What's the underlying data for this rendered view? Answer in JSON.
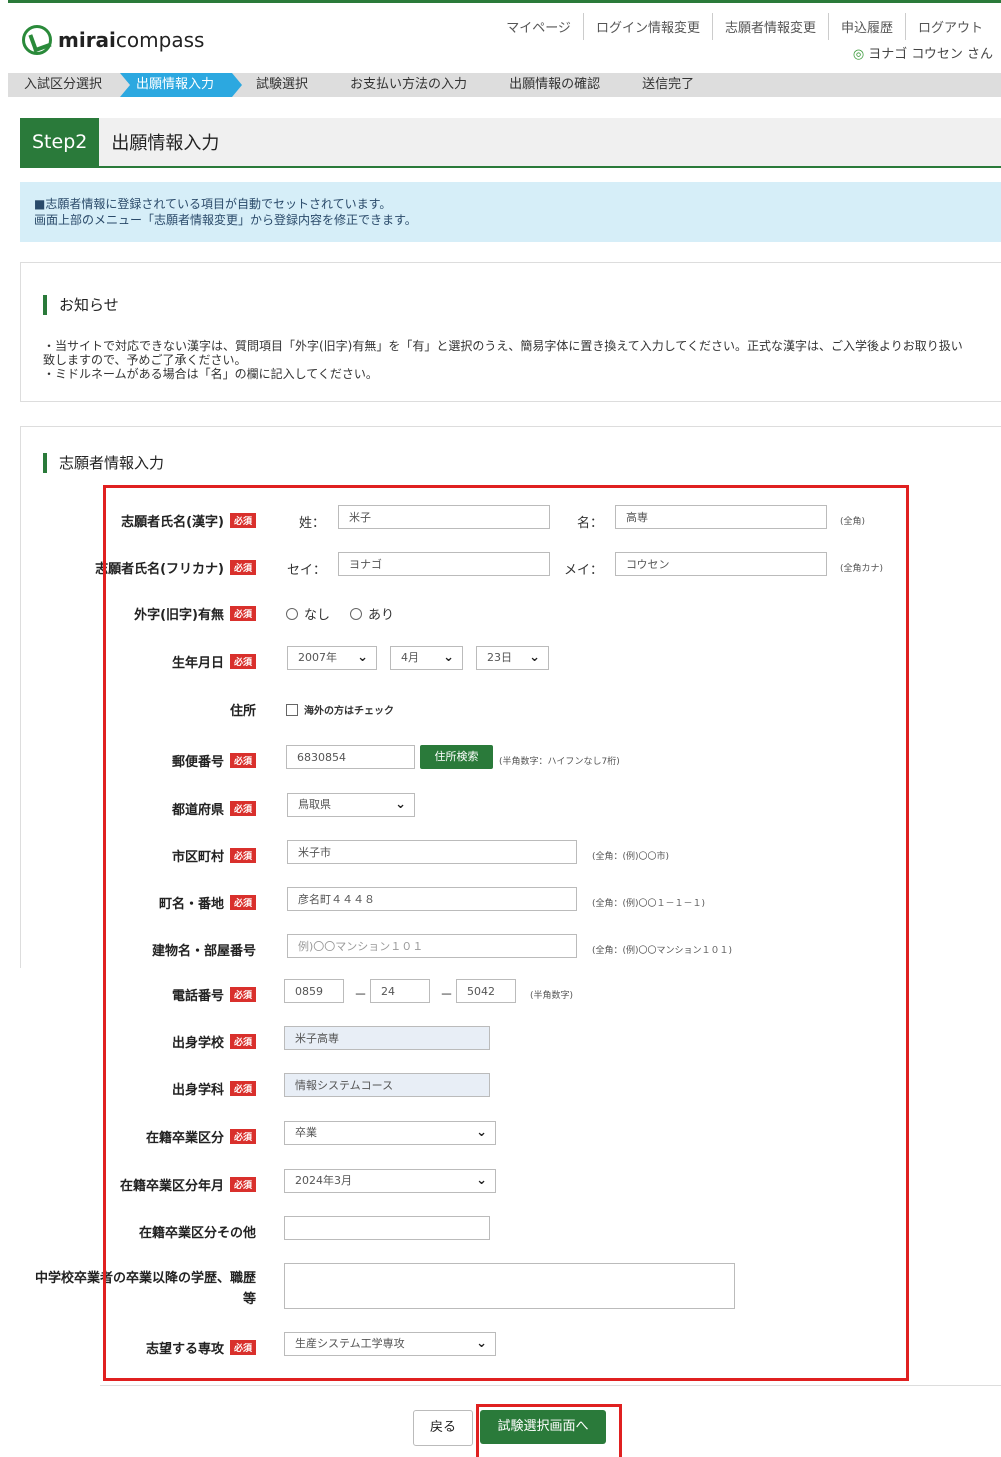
{
  "header": {
    "logo_bold": "mirai",
    "logo_rest": "compass",
    "nav": [
      "マイページ",
      "ログイン情報変更",
      "志願者情報変更",
      "申込履歴",
      "ログアウト"
    ],
    "user": "ヨナゴ コウセン さん"
  },
  "steps": [
    "入試区分選択",
    "出願情報入力",
    "試験選択",
    "お支払い方法の入力",
    "出願情報の確認",
    "送信完了"
  ],
  "step": {
    "num": "Step2",
    "title": "出願情報入力"
  },
  "info": {
    "line1": "■志願者情報に登録されている項目が自動でセットされています。",
    "line2": "画面上部のメニュー「志願者情報変更」から登録内容を修正できます。"
  },
  "notice": {
    "title": "お知らせ",
    "line1": "・当サイトで対応できない漢字は、質問項目「外字(旧字)有無」を「有」と選択のうえ、簡易字体に置き換えて入力してください。正式な漢字は、ご入学後よりお取り扱い",
    "line2": "致しますので、予めご了承ください。",
    "line3": "・ミドルネームがある場合は「名」の欄に記入してください。"
  },
  "form": {
    "title": "志願者情報入力",
    "required": "必須",
    "name_kanji": {
      "label": "志願者氏名(漢字)",
      "sei_label": "姓：",
      "sei": "米子",
      "mei_label": "名：",
      "mei": "高専",
      "hint": "(全角)"
    },
    "name_kana": {
      "label": "志願者氏名(フリカナ)",
      "sei_label": "セイ：",
      "sei": "ヨナゴ",
      "mei_label": "メイ：",
      "mei": "コウセン",
      "hint": "(全角カナ)"
    },
    "gaiji": {
      "label": "外字(旧字)有無",
      "opt1": "なし",
      "opt2": "あり"
    },
    "birth": {
      "label": "生年月日",
      "year": "2007年",
      "month": "4月",
      "day": "23日"
    },
    "address": {
      "label": "住所",
      "check": "海外の方はチェック"
    },
    "zip": {
      "label": "郵便番号",
      "value": "6830854",
      "button": "住所検索",
      "hint": "(半角数字：ハイフンなし7桁)"
    },
    "pref": {
      "label": "都道府県",
      "value": "鳥取県"
    },
    "city": {
      "label": "市区町村",
      "value": "米子市",
      "hint": "(全角：(例)〇〇市)"
    },
    "town": {
      "label": "町名・番地",
      "value": "彦名町４４４８",
      "hint": "(全角：(例)〇〇１－１－１)"
    },
    "building": {
      "label": "建物名・部屋番号",
      "placeholder": "例)〇〇マンション１０１",
      "hint": "(全角：(例)〇〇マンション１０１)"
    },
    "phone": {
      "label": "電話番号",
      "p1": "0859",
      "p2": "24",
      "p3": "5042",
      "dash": "－",
      "hint": "(半角数字)"
    },
    "school": {
      "label": "出身学校",
      "value": "米子高専"
    },
    "dept": {
      "label": "出身学科",
      "value": "情報システムコース"
    },
    "status": {
      "label": "在籍卒業区分",
      "value": "卒業"
    },
    "status_date": {
      "label": "在籍卒業区分年月",
      "value": "2024年3月"
    },
    "status_other": {
      "label": "在籍卒業区分その他",
      "value": ""
    },
    "history": {
      "label1": "中学校卒業者の卒業以降の学歴、職歴",
      "label2": "等"
    },
    "major": {
      "label": "志望する専攻",
      "value": "生産システム工学専攻"
    }
  },
  "buttons": {
    "back": "戻る",
    "next": "試験選択画面へ"
  }
}
